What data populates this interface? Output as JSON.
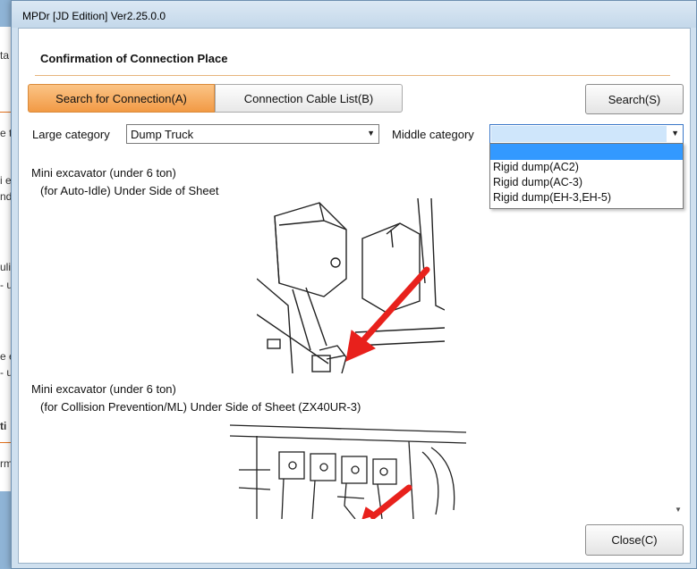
{
  "window": {
    "title": "MPDr [JD Edition] Ver2.25.0.0"
  },
  "background_text": [
    "ta D",
    "e ty",
    "i exc",
    "nde",
    "ulic",
    "- ur",
    "e ex",
    "- ur",
    "ti",
    "rm"
  ],
  "section": {
    "title": "Confirmation of Connection Place"
  },
  "tabs": [
    {
      "label": "Search for Connection(A)",
      "active": true
    },
    {
      "label": "Connection Cable List(B)",
      "active": false
    }
  ],
  "buttons": {
    "search": "Search(S)",
    "close": "Close(C)"
  },
  "filters": {
    "large_label": "Large category",
    "large_value": "Dump Truck",
    "middle_label": "Middle category",
    "middle_value": "",
    "middle_options": [
      "",
      "Rigid dump(AC2)",
      "Rigid dump(AC-3)",
      "Rigid dump(EH-3,EH-5)"
    ]
  },
  "results": [
    {
      "title": "Mini excavator (under 6 ton)",
      "subtitle": "(for Auto-Idle) Under Side of Sheet"
    },
    {
      "title": "Mini excavator (under 6 ton)",
      "subtitle": "(for Collision Prevention/ML) Under Side of Sheet (ZX40UR-3)"
    }
  ],
  "colors": {
    "accent_tab": "#f29a45",
    "selection": "#3399ff",
    "arrow": "#e8211c"
  },
  "icons": {
    "dropdown": "chevron-down-icon",
    "scroll_down": "scroll-down-arrow-icon"
  }
}
